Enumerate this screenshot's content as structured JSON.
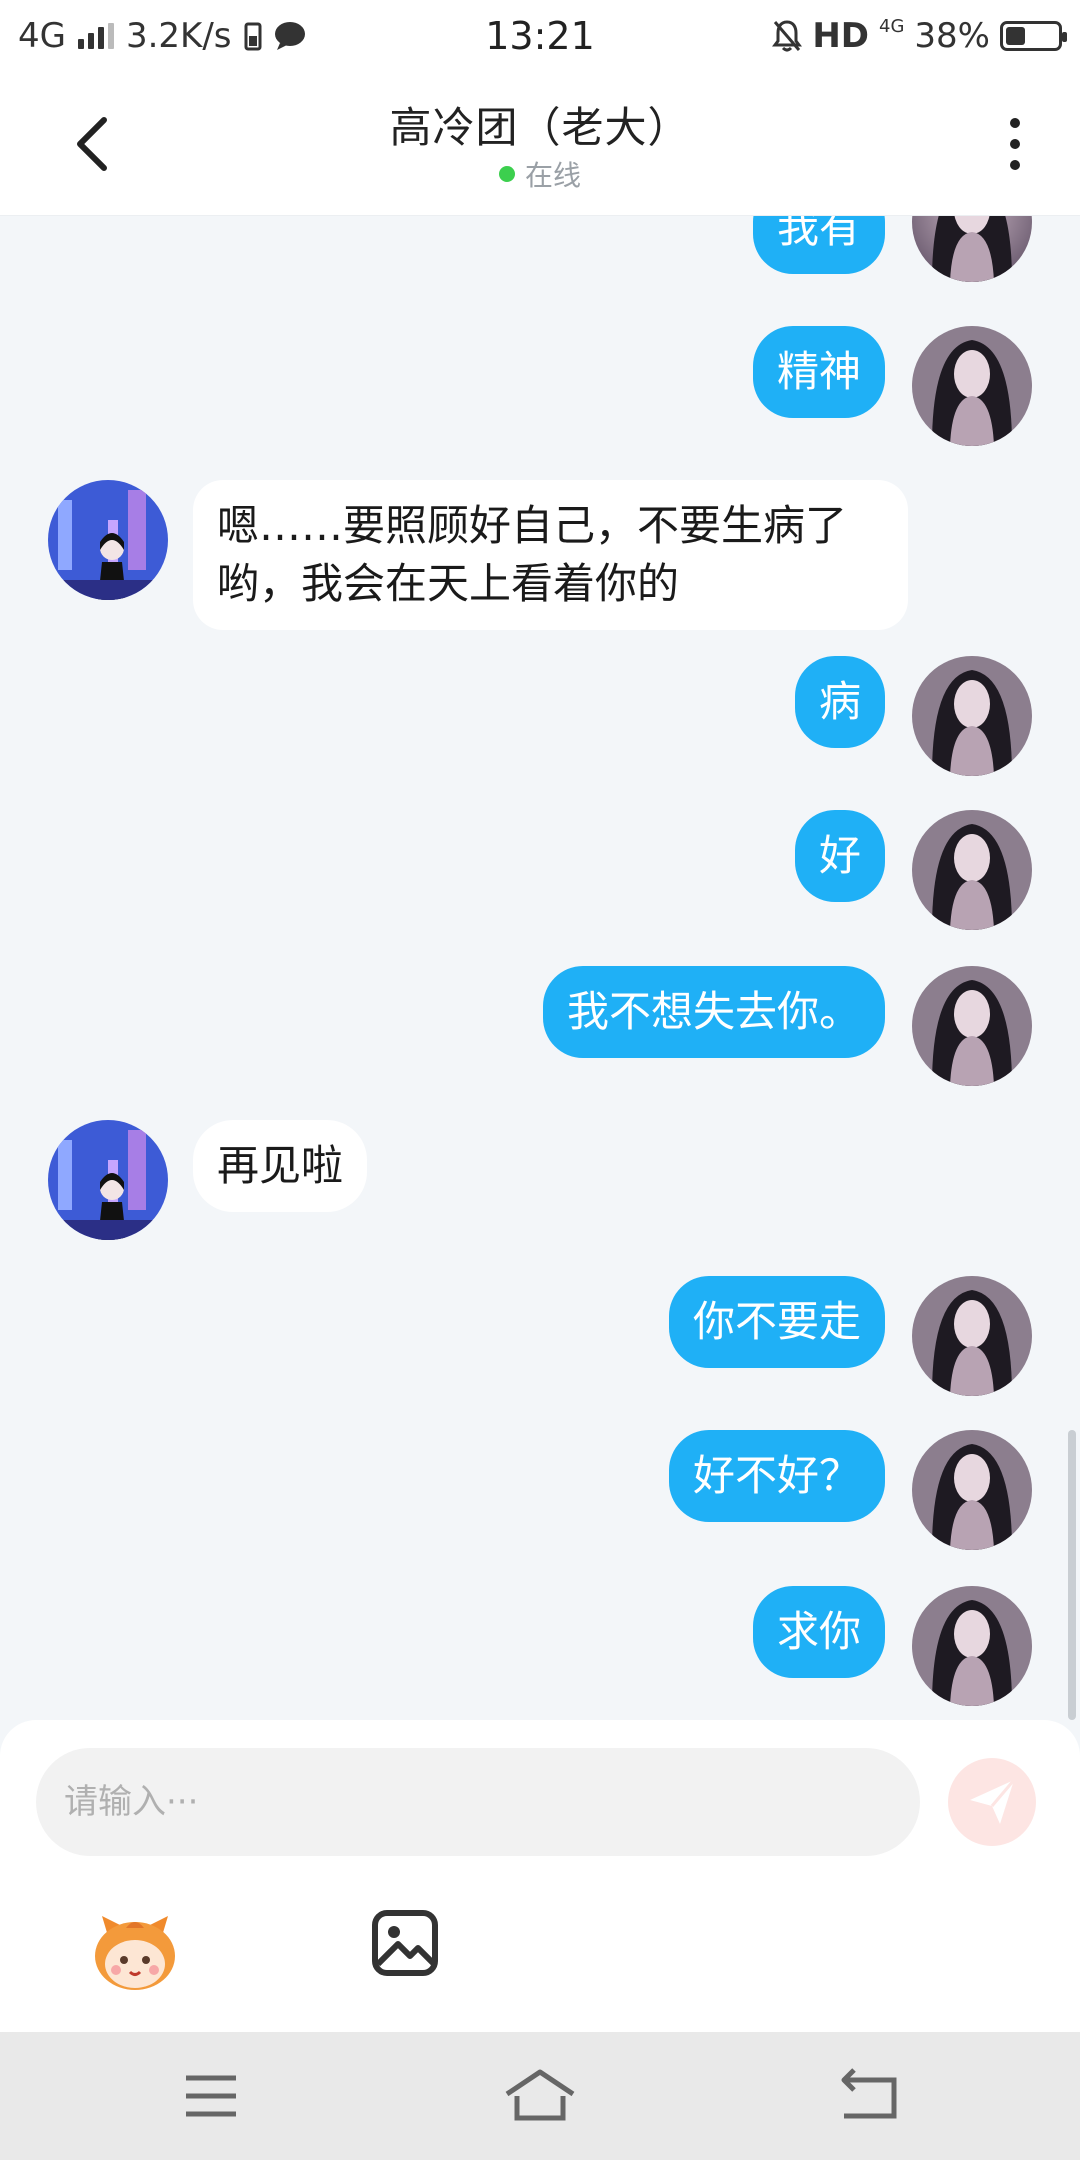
{
  "status_bar": {
    "network": "4G",
    "speed": "3.2K/s",
    "time": "13:21",
    "hd_label": "HD",
    "net_small": "4G",
    "battery_percent": "38%",
    "battery_level": 0.38
  },
  "header": {
    "title": "高冷团（老大）",
    "status": "在线",
    "online_color": "#3ccf4e"
  },
  "messages": [
    {
      "sender": "me",
      "text": "我有"
    },
    {
      "sender": "me",
      "text": "精神"
    },
    {
      "sender": "them",
      "text": "嗯……要照顾好自己，不要生病了哟，我会在天上看着你的"
    },
    {
      "sender": "me",
      "text": "病"
    },
    {
      "sender": "me",
      "text": "好"
    },
    {
      "sender": "me",
      "text": "我不想失去你。"
    },
    {
      "sender": "them",
      "text": "再见啦"
    },
    {
      "sender": "me",
      "text": "你不要走"
    },
    {
      "sender": "me",
      "text": "好不好？"
    },
    {
      "sender": "me",
      "text": "求你"
    }
  ],
  "input": {
    "placeholder": "请输入···"
  },
  "colors": {
    "my_bubble": "#1fb0f6",
    "their_bubble": "#ffffff",
    "background": "#f3f6f9",
    "send_button": "#fde5e3"
  },
  "icons": {
    "back": "chevron-left-icon",
    "more": "more-vertical-icon",
    "send": "send-icon",
    "emoji": "emoji-mascot-icon",
    "image": "image-icon",
    "nav_menu": "menu-icon",
    "nav_home": "home-icon",
    "nav_back": "back-arrow-icon"
  }
}
